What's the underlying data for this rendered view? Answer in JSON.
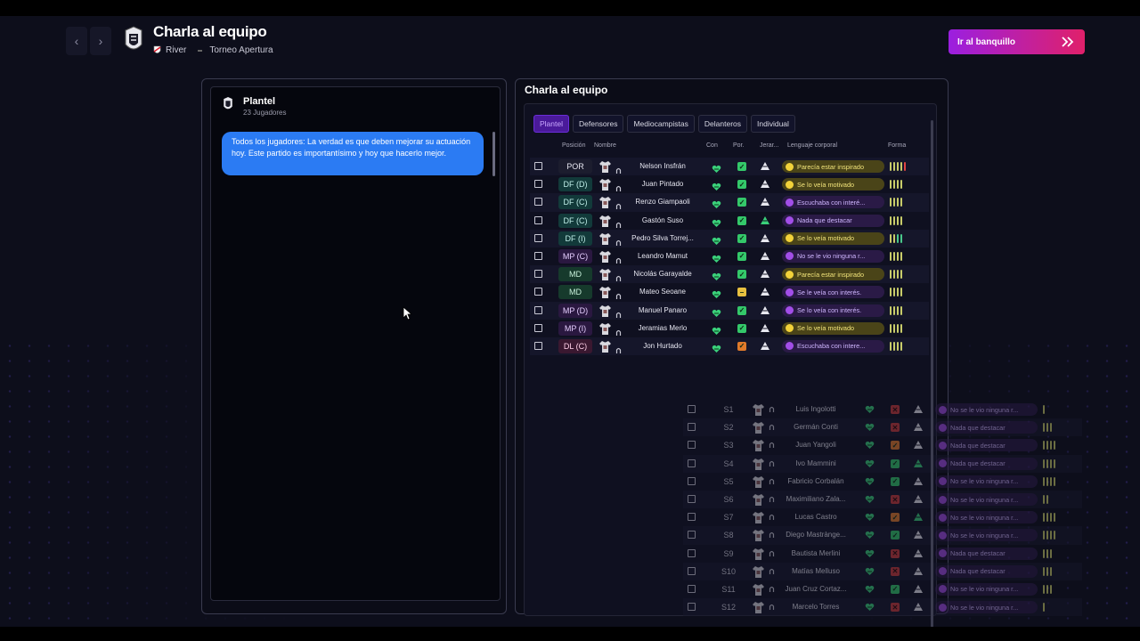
{
  "header": {
    "title": "Charla al equipo",
    "team": "River",
    "competition": "Torneo Apertura",
    "bench_button": "Ir al banquillo"
  },
  "left_panel": {
    "title": "Plantel",
    "subtitle": "23 Jugadores",
    "message": "Todos los jugadores:  La verdad es que deben mejorar su actuación hoy. Este partido es importantísimo y hoy que hacerlo mejor."
  },
  "right_panel": {
    "title": "Charla al equipo",
    "tabs": [
      "Plantel",
      "Defensores",
      "Mediocampistas",
      "Delanteros",
      "Individual"
    ],
    "active_tab": "Plantel",
    "columns": {
      "position": "Posición",
      "name": "Nombre",
      "con": "Con",
      "por": "Por.",
      "jerar": "Jerar...",
      "lenguaje": "Lenguaje corporal",
      "forma": "Forma"
    },
    "players": [
      {
        "pos": "POR",
        "cls": "gk",
        "name": "Nelson Insfrán",
        "fit": "ok",
        "rank": "white",
        "body": "Parecía estar inspirado",
        "mood": "happy",
        "form": [
          "y",
          "y",
          "y",
          "y",
          "r"
        ]
      },
      {
        "pos": "DF (D)",
        "cls": "df",
        "name": "Juan Pintado",
        "fit": "ok",
        "rank": "white",
        "body": "Se lo veía motivado",
        "mood": "happy",
        "form": [
          "y",
          "y",
          "y",
          "y"
        ]
      },
      {
        "pos": "DF (C)",
        "cls": "df",
        "name": "Renzo Giampaoli",
        "fit": "ok",
        "rank": "white",
        "body": "Escuchaba con interé...",
        "mood": "neutral",
        "form": [
          "y",
          "y",
          "y",
          "y"
        ]
      },
      {
        "pos": "DF (C)",
        "cls": "df",
        "name": "Gastón Suso",
        "fit": "ok",
        "rank": "green",
        "body": "Nada que destacar",
        "mood": "neutral",
        "form": [
          "y",
          "y",
          "y",
          "y"
        ]
      },
      {
        "pos": "DF (I)",
        "cls": "df",
        "name": "Pedro Silva Torrej...",
        "fit": "ok",
        "rank": "white",
        "body": "Se lo veía motivado",
        "mood": "happy",
        "form": [
          "y",
          "y",
          "g",
          "g"
        ]
      },
      {
        "pos": "MP (C)",
        "cls": "mp",
        "name": "Leandro Mamut",
        "fit": "ok",
        "rank": "white",
        "body": "No se le vio ninguna r...",
        "mood": "neutral",
        "form": [
          "y",
          "y",
          "y",
          "y"
        ]
      },
      {
        "pos": "MD",
        "cls": "md",
        "name": "Nicolás Garayalde",
        "fit": "ok",
        "rank": "white",
        "body": "Parecía estar inspirado",
        "mood": "happy",
        "form": [
          "y",
          "y",
          "y",
          "y"
        ]
      },
      {
        "pos": "MD",
        "cls": "md",
        "name": "Mateo Seoane",
        "fit": "mid",
        "rank": "white",
        "body": "Se le veía con interés.",
        "mood": "neutral",
        "form": [
          "y",
          "y",
          "y",
          "y"
        ]
      },
      {
        "pos": "MP (D)",
        "cls": "mp",
        "name": "Manuel Panaro",
        "fit": "ok",
        "rank": "white",
        "body": "Se lo veía con interés.",
        "mood": "neutral",
        "form": [
          "y",
          "y",
          "y",
          "y"
        ]
      },
      {
        "pos": "MP (I)",
        "cls": "mp",
        "name": "Jeramias Merlo",
        "fit": "ok",
        "rank": "white",
        "body": "Se lo veía motivado",
        "mood": "happy",
        "form": [
          "y",
          "y",
          "y",
          "y"
        ]
      },
      {
        "pos": "DL (C)",
        "cls": "dl",
        "name": "Jon Hurtado",
        "fit": "warn",
        "rank": "white",
        "body": "Escuchaba con intere...",
        "mood": "neutral",
        "form": [
          "y",
          "y",
          "y",
          "y"
        ]
      },
      {
        "pos": "S1",
        "cls": "sb",
        "name": "Luis Ingolotti",
        "fit": "no",
        "rank": "white",
        "body": "No se le vio ninguna r...",
        "mood": "neutral",
        "form": [
          "y"
        ]
      },
      {
        "pos": "S2",
        "cls": "sb",
        "name": "Germán Conti",
        "fit": "no",
        "rank": "white",
        "body": "Nada que destacar",
        "mood": "neutral",
        "form": [
          "y",
          "y",
          "y"
        ]
      },
      {
        "pos": "S3",
        "cls": "sb",
        "name": "Juan Yangoli",
        "fit": "warn",
        "rank": "white",
        "body": "Nada que destacar",
        "mood": "neutral",
        "form": [
          "y",
          "y",
          "y",
          "y"
        ]
      },
      {
        "pos": "S4",
        "cls": "sb",
        "name": "Ivo Mammini",
        "fit": "ok",
        "rank": "green",
        "body": "Nada que destacar",
        "mood": "neutral",
        "form": [
          "y",
          "y",
          "y",
          "y"
        ]
      },
      {
        "pos": "S5",
        "cls": "sb",
        "name": "Fabricio Corbalán",
        "fit": "ok",
        "rank": "white",
        "body": "No se le vio ninguna r...",
        "mood": "neutral",
        "form": [
          "y",
          "y",
          "y",
          "y"
        ]
      },
      {
        "pos": "S6",
        "cls": "sb",
        "name": "Maximiliano Zala...",
        "fit": "no",
        "rank": "white",
        "body": "No se le vio ninguna r...",
        "mood": "neutral",
        "form": [
          "y",
          "y"
        ]
      },
      {
        "pos": "S7",
        "cls": "sb",
        "name": "Lucas Castro",
        "fit": "warn",
        "rank": "green",
        "body": "No se le vio ninguna r...",
        "mood": "neutral",
        "form": [
          "y",
          "y",
          "y",
          "y"
        ]
      },
      {
        "pos": "S8",
        "cls": "sb",
        "name": "Diego Mastrànge...",
        "fit": "ok",
        "rank": "white",
        "body": "No se le vio ninguna r...",
        "mood": "neutral",
        "form": [
          "y",
          "y",
          "y",
          "y"
        ]
      },
      {
        "pos": "S9",
        "cls": "sb",
        "name": "Bautista Merlini",
        "fit": "no",
        "rank": "white",
        "body": "Nada que destacar",
        "mood": "neutral",
        "form": [
          "y",
          "y",
          "y"
        ]
      },
      {
        "pos": "S10",
        "cls": "sb",
        "name": "Matías Melluso",
        "fit": "no",
        "rank": "white",
        "body": "Nada que destacar",
        "mood": "neutral",
        "form": [
          "y",
          "y",
          "y"
        ]
      },
      {
        "pos": "S11",
        "cls": "sb",
        "name": "Juan Cruz Cortaz...",
        "fit": "ok",
        "rank": "white",
        "body": "No se le vio ninguna r...",
        "mood": "neutral",
        "form": [
          "y",
          "y",
          "y"
        ]
      },
      {
        "pos": "S12",
        "cls": "sb",
        "name": "Marcelo Torres",
        "fit": "no",
        "rank": "white",
        "body": "No se le vio ninguna r...",
        "mood": "neutral",
        "form": [
          "y"
        ]
      }
    ]
  },
  "icons": {
    "back": "chevron-left-icon",
    "forward": "chevron-right-icon",
    "bench": "double-chevron-right-icon",
    "crest": "club-crest-icon"
  },
  "colors": {
    "accent_start": "#9b1fe0",
    "accent_end": "#e0206a",
    "message_bubble": "#2b7bf3"
  }
}
